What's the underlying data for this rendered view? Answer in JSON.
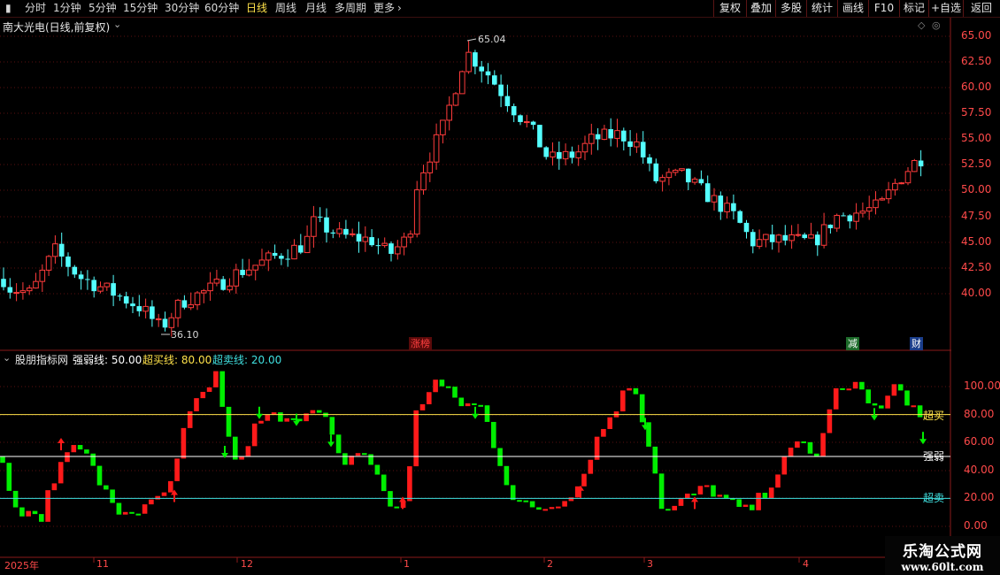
{
  "toolbar": {
    "periods": [
      "分时",
      "1分钟",
      "5分钟",
      "15分钟",
      "30分钟",
      "60分钟",
      "日线",
      "周线",
      "月线",
      "多周期",
      "更多"
    ],
    "active_period": "日线",
    "more_chevron": "›",
    "right_buttons": [
      "复权",
      "叠加",
      "多股",
      "统计",
      "画线",
      "F10",
      "标记",
      "+自选",
      "返回"
    ]
  },
  "main_panel": {
    "title": "南大光电(日线,前复权)",
    "price_axis": [
      "65.00",
      "62.50",
      "60.00",
      "57.50",
      "55.00",
      "52.50",
      "50.00",
      "47.50",
      "45.00",
      "42.50",
      "40.00"
    ],
    "high_label": "65.04",
    "low_label": "36.10",
    "event_tags": [
      {
        "text": "涨榜",
        "color": "#ff4040",
        "bg": "#5a0a0a"
      },
      {
        "text": "减",
        "color": "#ffffff",
        "bg": "#1d6b2a"
      },
      {
        "text": "财",
        "color": "#ffffff",
        "bg": "#1a3d8a"
      }
    ]
  },
  "indicator_panel": {
    "title": "股朋指标网",
    "lines": [
      {
        "label": "强弱线: 50.00",
        "color": "#ffffff"
      },
      {
        "label": "超买线: 80.00",
        "color": "#ffe24a"
      },
      {
        "label": "超卖线: 20.00",
        "color": "#40e0e0"
      }
    ],
    "axis": [
      "100.00",
      "80.00",
      "60.00",
      "40.00",
      "20.00",
      "0.00"
    ],
    "line_tags": {
      "overbought": "超买",
      "strength": "强弱",
      "oversold": "超卖"
    }
  },
  "date_axis": {
    "labels": [
      "2025年",
      "11",
      "12",
      "1",
      "2",
      "3",
      "4"
    ]
  },
  "watermark": {
    "line1": "乐淘公式网",
    "line2": "www.60lt.com"
  },
  "colors": {
    "up": "#ff3b3b",
    "down": "#54ffff",
    "ind_up": "#ff1a1a",
    "ind_down": "#00ee00",
    "overbought": "#ffe24a",
    "oversold": "#40e0e0",
    "strength": "#ffffff",
    "grid": "#5a1010"
  }
}
